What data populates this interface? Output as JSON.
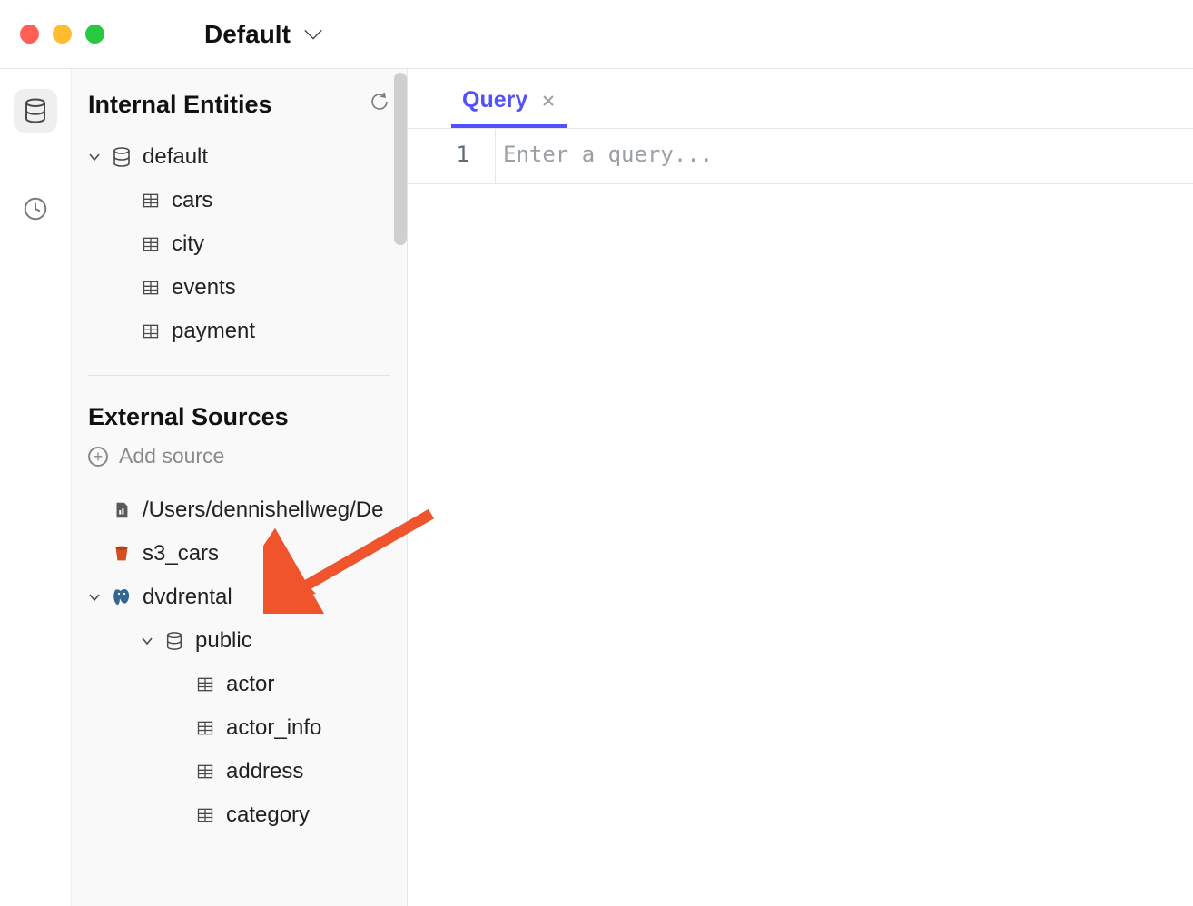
{
  "titlebar": {
    "workspace": "Default"
  },
  "sidebar": {
    "internal_title": "Internal Entities",
    "default_db": "default",
    "default_tables": [
      "cars",
      "city",
      "events",
      "payment"
    ],
    "external_title": "External Sources",
    "add_source_label": "Add source",
    "sources": {
      "file_path": "/Users/dennishellweg/De",
      "s3_name": "s3_cars",
      "pg_name": "dvdrental",
      "pg_schema": "public",
      "pg_tables": [
        "actor",
        "actor_info",
        "address",
        "category"
      ]
    }
  },
  "editor": {
    "tab_label": "Query",
    "gutter": "1",
    "placeholder": "Enter a query..."
  }
}
